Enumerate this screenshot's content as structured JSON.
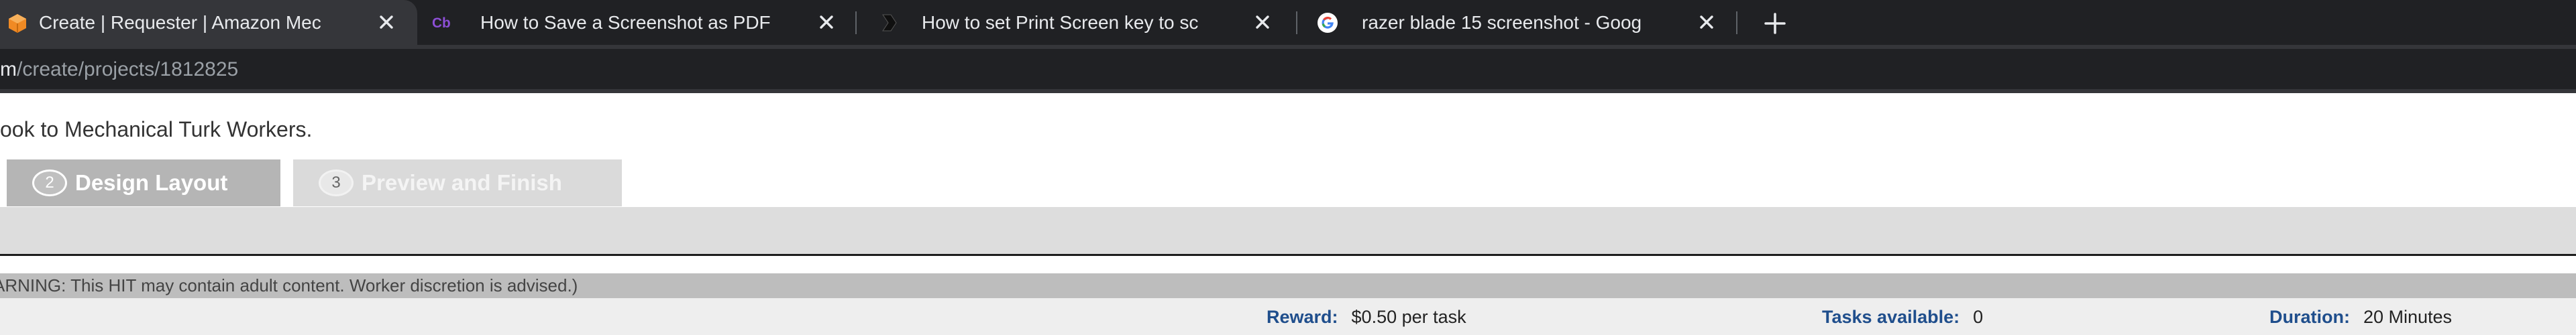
{
  "browser": {
    "tabs": [
      {
        "title": "Create | Requester | Amazon Mec",
        "favicon": "amazon-box-icon",
        "active": true
      },
      {
        "title": "How to Save a Screenshot as PDF",
        "favicon": "cb-logo-icon",
        "active": false
      },
      {
        "title": "How to set Print Screen key to sc",
        "favicon": "chevron-logo-icon",
        "active": false
      },
      {
        "title": "razer blade 15 screenshot - Goog",
        "favicon": "google-icon",
        "active": false
      }
    ],
    "url_host": "m",
    "url_path": "/create/projects/1812825"
  },
  "page": {
    "intro_text": "ook to Mechanical Turk Workers.",
    "steps": [
      {
        "number": "2",
        "label": "Design Layout"
      },
      {
        "number": "3",
        "label": "Preview and Finish"
      }
    ],
    "warning": "ARNING: This HIT may contain adult content. Worker discretion is advised.)",
    "info": {
      "reward_label": "Reward:",
      "reward_value": "$0.50 per task",
      "tasks_label": "Tasks available:",
      "tasks_value": "0",
      "duration_label": "Duration:",
      "duration_value": "20 Minutes"
    }
  },
  "colors": {
    "tabstrip": "#202124",
    "active_tab": "#35363a",
    "label_blue": "#1f4e8c",
    "step_active": "#b5b5b5",
    "step_inactive": "#dadada"
  }
}
